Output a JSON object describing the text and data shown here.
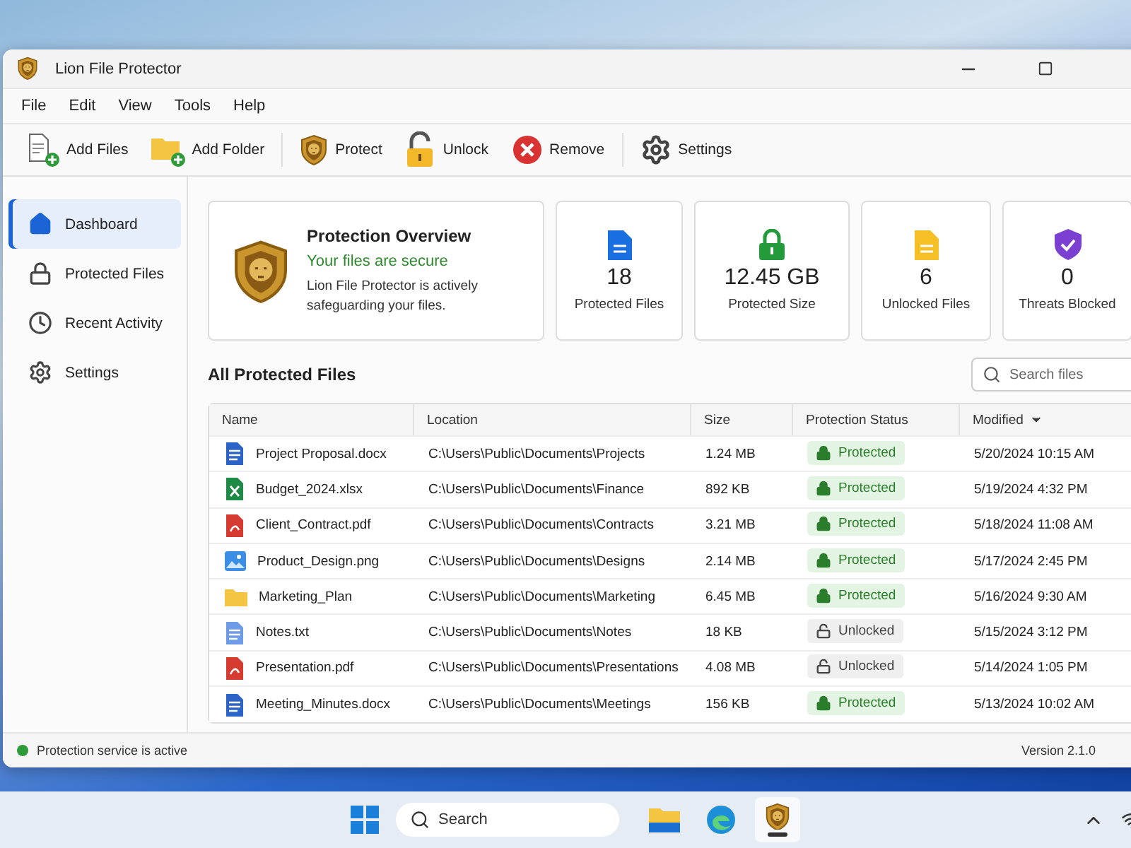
{
  "window": {
    "title": "Lion File Protector"
  },
  "menu": [
    "File",
    "Edit",
    "View",
    "Tools",
    "Help"
  ],
  "toolbar": [
    {
      "label": "Add Files",
      "kind": "add-files"
    },
    {
      "label": "Add Folder",
      "kind": "add-folder"
    },
    {
      "label": "Protect",
      "kind": "protect"
    },
    {
      "label": "Unlock",
      "kind": "unlock"
    },
    {
      "label": "Remove",
      "kind": "remove"
    },
    {
      "label": "Settings",
      "kind": "settings"
    }
  ],
  "sidebar": {
    "items": [
      {
        "label": "Dashboard",
        "kind": "dashboard",
        "selected": true
      },
      {
        "label": "Protected Files",
        "kind": "lock",
        "selected": false
      },
      {
        "label": "Recent Activity",
        "kind": "clock",
        "selected": false
      },
      {
        "label": "Settings",
        "kind": "gear",
        "selected": false
      }
    ]
  },
  "overview": {
    "title": "Protection Overview",
    "status": "Your files are secure",
    "description": "Lion File Protector is actively safeguarding your files."
  },
  "stats": [
    {
      "value": "18",
      "label": "Protected Files",
      "kind": "file"
    },
    {
      "value": "12.45 GB",
      "label": "Protected Size",
      "kind": "lock"
    },
    {
      "value": "6",
      "label": "Unlocked Files",
      "kind": "doc"
    },
    {
      "value": "0",
      "label": "Threats Blocked",
      "kind": "shield"
    }
  ],
  "files": {
    "title": "All Protected Files",
    "search": {
      "placeholder": "Search files"
    },
    "columns": [
      {
        "label": "Name",
        "sorted": false
      },
      {
        "label": "Location",
        "sorted": false
      },
      {
        "label": "Size",
        "sorted": false
      },
      {
        "label": "Protection Status",
        "sorted": false
      },
      {
        "label": "Modified",
        "sorted": true
      }
    ],
    "rows": [
      {
        "name": "Project Proposal.docx",
        "kind": "word",
        "location": "C:\\Users\\Public\\Documents\\Projects",
        "size": "1.24 MB",
        "status": "Protected",
        "protected": true,
        "modified": "5/20/2024 10:15 AM"
      },
      {
        "name": "Budget_2024.xlsx",
        "kind": "excel",
        "location": "C:\\Users\\Public\\Documents\\Finance",
        "size": "892 KB",
        "status": "Protected",
        "protected": true,
        "modified": "5/19/2024 4:32 PM"
      },
      {
        "name": "Client_Contract.pdf",
        "kind": "pdf",
        "location": "C:\\Users\\Public\\Documents\\Contracts",
        "size": "3.21 MB",
        "status": "Protected",
        "protected": true,
        "modified": "5/18/2024 11:08 AM"
      },
      {
        "name": "Product_Design.png",
        "kind": "image",
        "location": "C:\\Users\\Public\\Documents\\Designs",
        "size": "2.14 MB",
        "status": "Protected",
        "protected": true,
        "modified": "5/17/2024 2:45 PM"
      },
      {
        "name": "Marketing_Plan",
        "kind": "folder",
        "location": "C:\\Users\\Public\\Documents\\Marketing",
        "size": "6.45 MB",
        "status": "Protected",
        "protected": true,
        "modified": "5/16/2024 9:30 AM"
      },
      {
        "name": "Notes.txt",
        "kind": "text",
        "location": "C:\\Users\\Public\\Documents\\Notes",
        "size": "18 KB",
        "status": "Unlocked",
        "protected": false,
        "modified": "5/15/2024 3:12 PM"
      },
      {
        "name": "Presentation.pdf",
        "kind": "pdf",
        "location": "C:\\Users\\Public\\Documents\\Presentations",
        "size": "4.08 MB",
        "status": "Unlocked",
        "protected": false,
        "modified": "5/14/2024 1:05 PM"
      },
      {
        "name": "Meeting_Minutes.docx",
        "kind": "word",
        "location": "C:\\Users\\Public\\Documents\\Meetings",
        "size": "156 KB",
        "status": "Protected",
        "protected": true,
        "modified": "5/13/2024 10:02 AM"
      }
    ]
  },
  "status_bar": {
    "message": "Protection service is active",
    "active": true,
    "version": "Version 2.1.0"
  },
  "taskbar": {
    "search": {
      "placeholder": "Search"
    },
    "apps": [
      {
        "kind": "explorer",
        "selected": false
      },
      {
        "kind": "edge",
        "selected": false
      },
      {
        "kind": "lion",
        "selected": true
      }
    ]
  }
}
